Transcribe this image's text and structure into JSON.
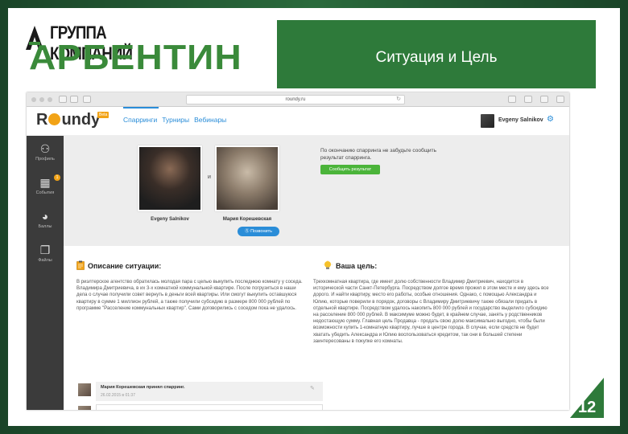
{
  "slide": {
    "logo_top": "ГРУППА КОМПАНИЙ",
    "logo_main": "АРБЕНТИН",
    "title": "Ситуация и Цель",
    "page_number": "12"
  },
  "browser": {
    "url": "roundy.ru"
  },
  "app": {
    "brand_left": "R",
    "brand_right": "undy",
    "beta": "Beta",
    "nav": [
      "Спарринги",
      "Турниры",
      "Вебинары"
    ],
    "user_name": "Evgeny Salnikov"
  },
  "sidebar": [
    {
      "icon": "profile-icon",
      "label": "Профиль"
    },
    {
      "icon": "calendar-icon",
      "label": "События",
      "badge": "1"
    },
    {
      "icon": "piggy-bank-icon",
      "label": "Баллы"
    },
    {
      "icon": "files-icon",
      "label": "Файлы"
    }
  ],
  "sparring": {
    "participant1": "Evgeny Salnikov",
    "participant2": "Мария Корешевская",
    "and": "и",
    "call_button": "Позвонить",
    "note": "По окончанию спарринга не забудьте сообщить результат спарринга.",
    "result_button": "Сообщить результат"
  },
  "situation": {
    "heading": "Описание ситуации:",
    "text": "В риэлтерское агентство обратилась молодая пара с целью выкупить последнюю комнату у соседа. Владимира Дмитриевича, в их 3-х комнатной коммунальной квартире. После погрузиться в наши дела о случае получили совет вернуть в деньги всей квартиры. Или смогут выкупить оставшуюся квартиру в сумме 1 миллион рублей, а также получили субсидию в размере 800 000 рублей по программе \"Расселение коммунальных квартир\". Сами договорились с соседом пока не удалось."
  },
  "goal": {
    "heading": "Ваша цель:",
    "text": "Трехкомнатная квартира, где имеет долю собственности Владимир Дмитриевич, находится в исторической части Санкт-Петербурга. Посредством долгое время прожил в этом месте и ему здесь все дорого. И найти квартиру, место его работы, особые отношения. Однако, с помощью Александра и Юлию, которые поверили в порядок, договоры с Владимиру Дмитриевичу также обязали придать в отдельной квартире. Посредством удалось накопить 800 000 рублей и государство выделило субсидию на расселение 800 000 рублей. В максимуме можно будет, в крайнем случае, занять у родственников недостающую сумму. Главная цель Продавца - продать свою долю максимально выгодно, чтобы были возможности купить 1-комнатную квартиру, лучше в центре города. В случае, если средств не будет хватать убедить Александра и Юлию воспользоваться кредитом, так они в большей степени заинтересованы в покупке его комнаты."
  },
  "comment": {
    "title": "Мария Корешевская принял спарринг.",
    "date": "26.02.2015 в 01:37"
  },
  "colors": {
    "green_dark": "#1d4a2c",
    "title_green": "#2e7a3a",
    "roundy_orange": "#f2a316",
    "link_blue": "#2a8dd8",
    "btn_green": "#4bb43a"
  }
}
